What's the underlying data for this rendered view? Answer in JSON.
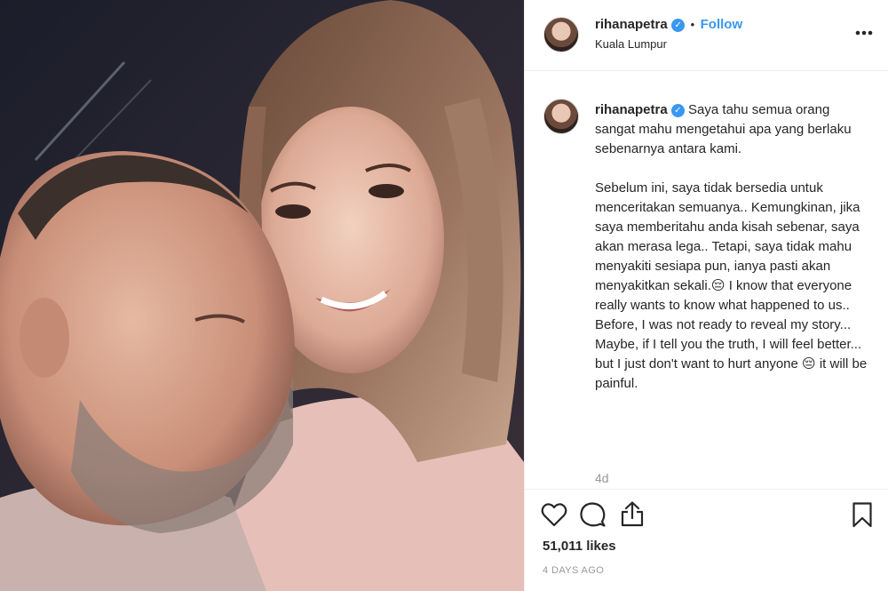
{
  "post": {
    "username": "rihanapetra",
    "follow_label": "Follow",
    "separator": "•",
    "location": "Kuala Lumpur",
    "more_label": "•••",
    "caption": "Saya tahu semua orang sangat mahu mengetahui apa yang berlaku sebenarnya antara kami.\n\nSebelum ini, saya tidak bersedia untuk menceritakan semuanya.. Kemungkinan, jika saya memberitahu anda kisah sebenar, saya akan merasa lega.. Tetapi, saya tidak mahu menyakiti sesiapa pun, ianya pasti akan menyakitkan sekali.😔 I know that everyone really wants to know what happened to us.. Before, I was not ready to reveal my story... Maybe, if I tell you the truth, I will feel better... but I just don't want to hurt anyone 😔 it will be painful.",
    "comment_age": "4d",
    "likes": "51,011 likes",
    "posted_ago": "4 DAYS AGO"
  },
  "icons": {
    "verified": "verified-badge-icon",
    "like": "heart-icon",
    "comment": "comment-icon",
    "share": "share-icon",
    "save": "bookmark-icon"
  },
  "colors": {
    "accent": "#3897f0",
    "text": "#262626",
    "muted": "#999999",
    "border": "#efefef"
  }
}
